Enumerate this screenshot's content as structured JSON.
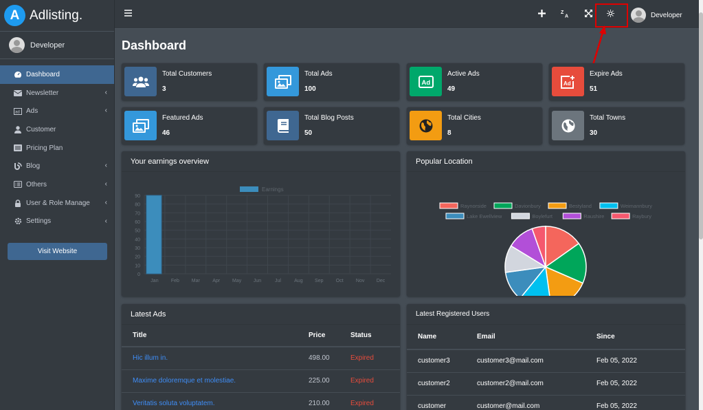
{
  "brand": {
    "logo_letter": "A",
    "name": "Adlisting."
  },
  "sidebar": {
    "user_name": "Developer",
    "items": [
      {
        "label": "Dashboard",
        "icon": "dashboard-icon",
        "active": true,
        "has_caret": false
      },
      {
        "label": "Newsletter",
        "icon": "envelope-icon",
        "active": false,
        "has_caret": true
      },
      {
        "label": "Ads",
        "icon": "ad-icon",
        "active": false,
        "has_caret": true
      },
      {
        "label": "Customer",
        "icon": "user-icon",
        "active": false,
        "has_caret": false
      },
      {
        "label": "Pricing Plan",
        "icon": "list-icon",
        "active": false,
        "has_caret": false
      },
      {
        "label": "Blog",
        "icon": "blog-icon",
        "active": false,
        "has_caret": true
      },
      {
        "label": "Others",
        "icon": "list-alt-icon",
        "active": false,
        "has_caret": true
      },
      {
        "label": "User & Role Manage",
        "icon": "lock-icon",
        "active": false,
        "has_caret": true
      },
      {
        "label": "Settings",
        "icon": "gear-icon",
        "active": false,
        "has_caret": true
      }
    ],
    "visit_button": "Visit Website"
  },
  "topbar": {
    "user_name": "Developer",
    "icons": [
      "menu-icon",
      "plus-icon",
      "translate-icon",
      "expand-icon",
      "theme-toggle-icon"
    ]
  },
  "page": {
    "title": "Dashboard"
  },
  "stats": [
    {
      "label": "Total Customers",
      "value": "3",
      "color": "#3f6791",
      "icon": "users-icon"
    },
    {
      "label": "Total Ads",
      "value": "100",
      "color": "#3498db",
      "icon": "images-icon"
    },
    {
      "label": "Active Ads",
      "value": "49",
      "color": "#00a86b",
      "icon": "ad-icon"
    },
    {
      "label": "Expire Ads",
      "value": "51",
      "color": "#e74c3c",
      "icon": "ad-expire-icon"
    },
    {
      "label": "Featured Ads",
      "value": "46",
      "color": "#3498db",
      "icon": "images-icon"
    },
    {
      "label": "Total Blog Posts",
      "value": "50",
      "color": "#3f6791",
      "icon": "book-icon"
    },
    {
      "label": "Total Cities",
      "value": "8",
      "color": "#f39c12",
      "icon": "globe-icon"
    },
    {
      "label": "Total Towns",
      "value": "30",
      "color": "#6c757d",
      "icon": "globe-icon"
    }
  ],
  "earnings": {
    "title": "Your earnings overview",
    "chart_data": {
      "type": "bar",
      "categories": [
        "Jan",
        "Feb",
        "Mar",
        "Apr",
        "May",
        "Jun",
        "Jul",
        "Aug",
        "Sep",
        "Oct",
        "Nov",
        "Dec"
      ],
      "series": [
        {
          "name": "Earnings",
          "values": [
            90,
            0,
            0,
            0,
            0,
            0,
            0,
            0,
            0,
            0,
            0,
            0
          ]
        }
      ],
      "yticks": [
        "90",
        "80",
        "70",
        "60",
        "50",
        "40",
        "30",
        "20",
        "10",
        "0"
      ],
      "ylim": [
        0,
        90
      ],
      "color": "#3c8dbc"
    }
  },
  "popular_location": {
    "title": "Popular Location",
    "chart_data": {
      "type": "pie",
      "labels": [
        "Raynorside",
        "Davionbury",
        "Bestyland",
        "Weimannbury",
        "Lake Ewellview",
        "Boylefurt",
        "Raushire",
        "Raybury"
      ],
      "values": [
        14,
        15,
        15,
        12,
        11,
        10,
        10,
        5
      ],
      "colors": [
        "#f4665c",
        "#00a65a",
        "#f39c12",
        "#00c0ef",
        "#3c8dbc",
        "#d2d6de",
        "#b24fd8",
        "#f5586e"
      ]
    }
  },
  "latest_ads": {
    "title": "Latest Ads",
    "columns": [
      "Title",
      "Price",
      "Status"
    ],
    "rows": [
      {
        "title": "Hic illum in.",
        "price": "498.00",
        "status": "Expired"
      },
      {
        "title": "Maxime doloremque et molestiae.",
        "price": "225.00",
        "status": "Expired"
      },
      {
        "title": "Veritatis soluta voluptatem.",
        "price": "210.00",
        "status": "Expired"
      }
    ]
  },
  "latest_users": {
    "title": "Latest Registered Users",
    "columns": [
      "Name",
      "Email",
      "Since"
    ],
    "rows": [
      {
        "name": "customer3",
        "email": "customer3@mail.com",
        "since": "Feb 05, 2022"
      },
      {
        "name": "customer2",
        "email": "customer2@mail.com",
        "since": "Feb 05, 2022"
      },
      {
        "name": "customer",
        "email": "customer@mail.com",
        "since": "Feb 05, 2022"
      }
    ]
  }
}
